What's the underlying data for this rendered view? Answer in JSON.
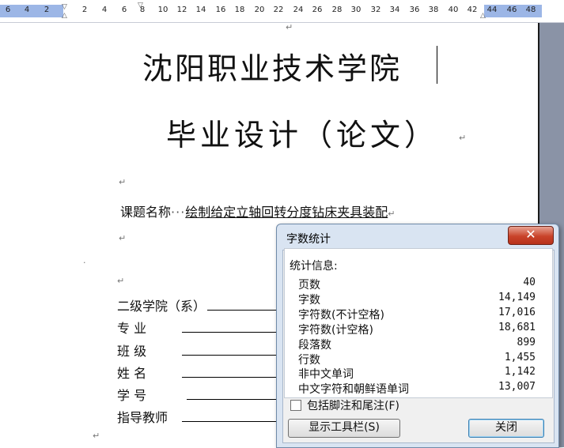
{
  "ruler": {
    "left_numbers": [
      "6",
      "4",
      "2"
    ],
    "numbers": [
      "2",
      "4",
      "6",
      "8",
      "10",
      "12",
      "14",
      "16",
      "18",
      "20",
      "22",
      "24",
      "26",
      "28",
      "30",
      "32",
      "34",
      "36",
      "38",
      "40",
      "42"
    ],
    "right_numbers": [
      "44",
      "46",
      "48"
    ]
  },
  "document": {
    "title_line1": "沈阳职业技术学院",
    "title_line2": "毕业设计（论文）",
    "topic_label": "课题名称",
    "topic_value": "绘制给定立轴回转分度钻床夹具装配",
    "form_labels": [
      "二级学院（系）",
      "专    业",
      "班    级",
      "姓    名",
      "学    号",
      "指导教师"
    ],
    "paragraph_mark": "↵"
  },
  "dialog": {
    "title": "字数统计",
    "close_icon": "✕",
    "info_label": "统计信息:",
    "stats": [
      {
        "label": "页数",
        "value": "40"
      },
      {
        "label": "字数",
        "value": "14,149"
      },
      {
        "label": "字符数(不计空格)",
        "value": "17,016"
      },
      {
        "label": "字符数(计空格)",
        "value": "18,681"
      },
      {
        "label": "段落数",
        "value": "899"
      },
      {
        "label": "行数",
        "value": "1,455"
      },
      {
        "label": "非中文单词",
        "value": "1,142"
      },
      {
        "label": "中文字符和朝鲜语单词",
        "value": "13,007"
      }
    ],
    "checkbox_label": "包括脚注和尾注(F)",
    "checkbox_checked": false,
    "toolbar_button": "显示工具栏(S)",
    "close_button": "关闭"
  }
}
